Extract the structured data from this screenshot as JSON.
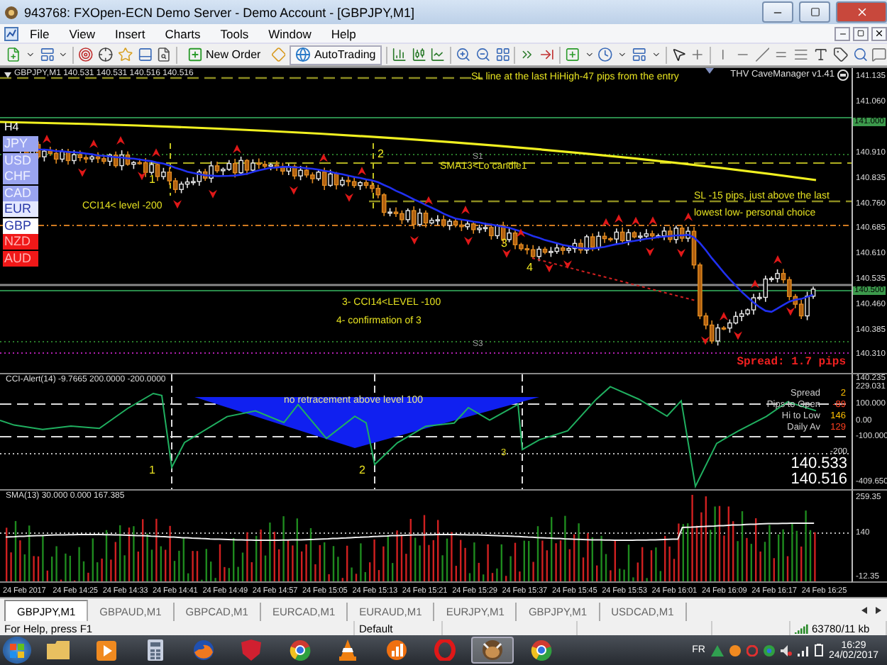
{
  "window": {
    "title": "943768: FXOpen-ECN Demo Server - Demo Account - [GBPJPY,M1]"
  },
  "menu": [
    "File",
    "View",
    "Insert",
    "Charts",
    "Tools",
    "Window",
    "Help"
  ],
  "toolbar": {
    "buttons": [
      {
        "label": "New Order"
      },
      {
        "label": "AutoTrading"
      }
    ]
  },
  "chart": {
    "header": "GBPJPY,M1  140.531 140.531 140.516 140.516",
    "indicator": "THV CaveManager v1.41",
    "timeframe": "H4",
    "currencies": [
      {
        "label": "JPY",
        "color": "#9aa4f0"
      },
      {
        "label": "USD",
        "color": "#9aa4f0"
      },
      {
        "label": "CHF",
        "color": "#9aa4f0"
      },
      {
        "label": "CAD",
        "color": "#9aa4f0"
      },
      {
        "label": "EUR",
        "color": "#e4e8ff"
      },
      {
        "label": "GBP",
        "color": "#ffffff"
      },
      {
        "label": "NZD",
        "color": "#f01818"
      },
      {
        "label": "AUD",
        "color": "#f01818"
      }
    ],
    "notes": [
      "SL line at the last HiHigh-47 pips from the entry",
      "SMA13<Lo candle1",
      "CCI14< level -200",
      "SL -15 pips, just above the last",
      "lowest low- personal choice",
      "3- CCI14<LEVEL -100",
      "4- confirmation of 3"
    ],
    "markers": [
      "1",
      "2",
      "3",
      "4"
    ],
    "level_labels": [
      "S1",
      "S3"
    ],
    "spread": "Spread: 1.7 pips",
    "price_axis": [
      "141.135",
      "141.060",
      "140.910",
      "140.835",
      "140.760",
      "140.685",
      "140.610",
      "140.535",
      "140.460",
      "140.385",
      "140.310"
    ],
    "price_tags": [
      "141.000",
      "140.500"
    ]
  },
  "cci": {
    "header": "CCI-Alert(14) -9.7665 200.0000 -200.0000",
    "note": "no retracement above level 100",
    "markers": [
      "1",
      "2",
      "3"
    ],
    "level_label": "-200",
    "axis": [
      "140.235",
      "229.031",
      "100.000",
      "0.00",
      "-100.000",
      "-409.650"
    ],
    "stats": [
      {
        "label": "Spread",
        "value": "2",
        "color": "#ffc000"
      },
      {
        "label": "Pips to Open",
        "value": "-89",
        "color": "#ff4020"
      },
      {
        "label": "Hi to Low",
        "value": "146",
        "color": "#ffc000"
      },
      {
        "label": "Daily Av",
        "value": "129",
        "color": "#ff4020"
      }
    ],
    "bid": "140.533",
    "ask": "140.516"
  },
  "volume": {
    "header": "SMA(13) 30.000 0.000 167.385",
    "axis": [
      "259.35",
      "140",
      "-12.35"
    ]
  },
  "time_axis": [
    "24 Feb 2017",
    "24 Feb 14:25",
    "24 Feb 14:33",
    "24 Feb 14:41",
    "24 Feb 14:49",
    "24 Feb 14:57",
    "24 Feb 15:05",
    "24 Feb 15:13",
    "24 Feb 15:21",
    "24 Feb 15:29",
    "24 Feb 15:37",
    "24 Feb 15:45",
    "24 Feb 15:53",
    "24 Feb 16:01",
    "24 Feb 16:09",
    "24 Feb 16:17",
    "24 Feb 16:25"
  ],
  "tabs": [
    {
      "label": "GBPJPY,M1",
      "selected": true
    },
    {
      "label": "GBPAUD,M1",
      "selected": false
    },
    {
      "label": "GBPCAD,M1",
      "selected": false
    },
    {
      "label": "EURCAD,M1",
      "selected": false
    },
    {
      "label": "EURAUD,M1",
      "selected": false
    },
    {
      "label": "EURJPY,M1",
      "selected": false
    },
    {
      "label": "GBPJPY,M1",
      "selected": false
    },
    {
      "label": "USDCAD,M1",
      "selected": false
    }
  ],
  "status_bar": {
    "help": "For Help, press F1",
    "profile": "Default",
    "traffic": "63780/11 kb"
  },
  "taskbar": {
    "language": "FR",
    "time": "16:29",
    "date": "24/02/2017"
  }
}
